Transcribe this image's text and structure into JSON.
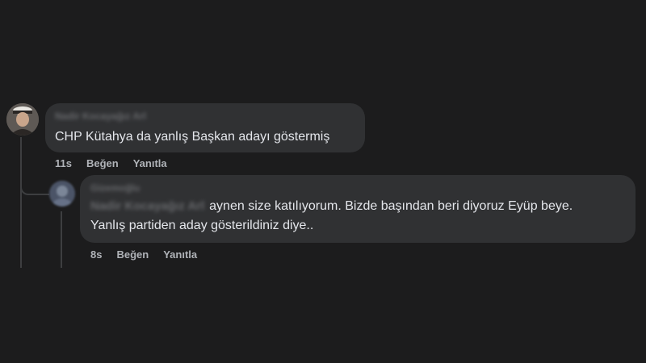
{
  "comments": [
    {
      "author": "Nadir Kocayağız Arl",
      "text": "CHP Kütahya da yanlış Başkan adayı göstermiş",
      "time": "11s",
      "like_label": "Beğen",
      "reply_label": "Yanıtla"
    }
  ],
  "reply": {
    "author": "Gizemoğlu",
    "mention": "Nadir Kocayağız Arl",
    "text_line1": "aynen size katılıyorum. Bizde başından beri diyoruz Eyüp beye.",
    "text_line2": "Yanlış partiden aday gösterildiniz diye..",
    "time": "8s",
    "like_label": "Beğen",
    "reply_label": "Yanıtla"
  },
  "colors": {
    "background": "#1c1c1d",
    "bubble": "#303133",
    "text": "#e4e6eb",
    "muted": "#b0b3b8"
  }
}
